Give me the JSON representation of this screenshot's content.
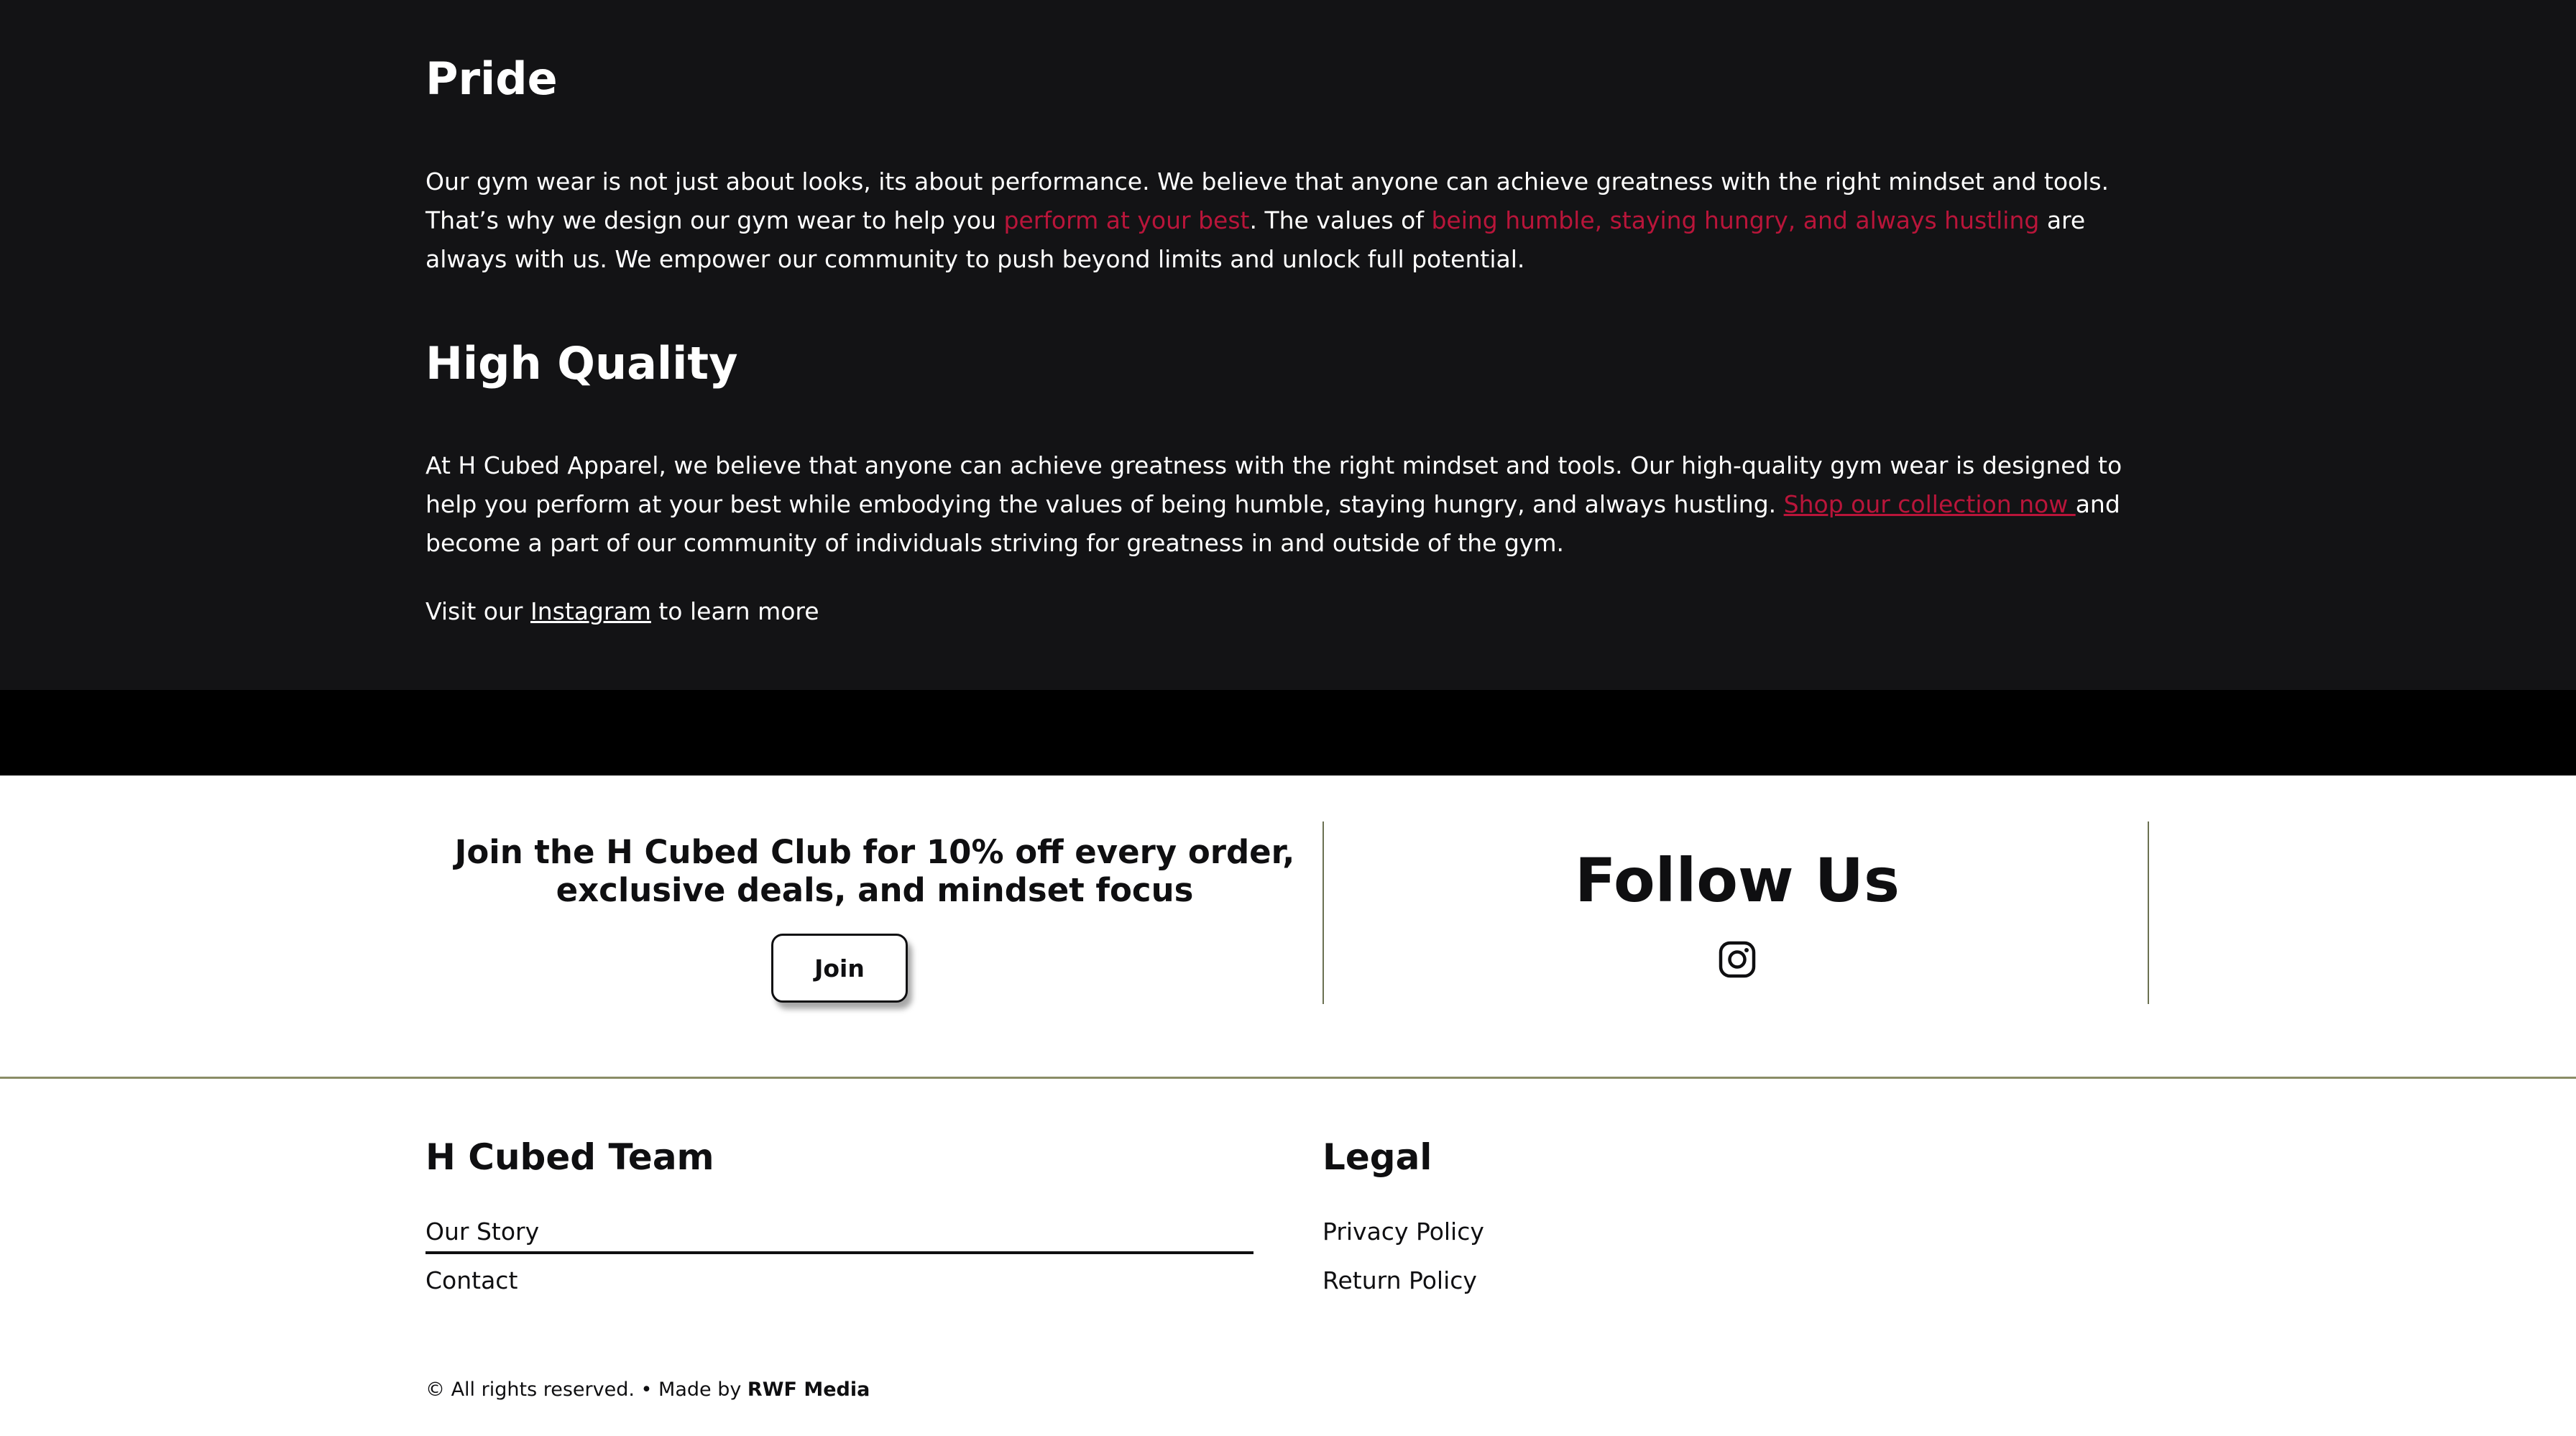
{
  "pride": {
    "heading": "Pride",
    "p1_a": "Our gym wear is not just about looks, its about performance. We believe that anyone can achieve greatness with the right mindset and tools. That’s why we design our gym wear to help you ",
    "p1_hl1": "perform at your best",
    "p1_b": ". The values of ",
    "p1_hl2": "being humble, staying hungry, and always hustling",
    "p1_c": " are always with us. We empower our community to push beyond limits and unlock full potential."
  },
  "quality": {
    "heading": "High Quality",
    "p2_a": "At H Cubed Apparel, we believe that anyone can achieve greatness with the right mindset and tools. Our high-quality gym wear is designed to help you perform at your best while embodying the values of being humble, staying hungry, and always hustling. ",
    "p2_link": "Shop our collection now ",
    "p2_b": "and become a part of our community of individuals striving for greatness in and outside of the gym.",
    "visit_a": "Visit our ",
    "visit_link": "Instagram",
    "visit_b": " to learn more"
  },
  "promo": {
    "join_line1": "Join the H Cubed Club for 10% off every order,",
    "join_line2": "exclusive deals, and mindset focus",
    "join_button": "Join",
    "follow_title": "Follow Us",
    "follow_icon": "instagram-icon"
  },
  "footer": {
    "team_heading": "H Cubed Team",
    "team_links": [
      "Our Story",
      "Contact"
    ],
    "legal_heading": "Legal",
    "legal_links": [
      "Privacy Policy",
      "Return Policy"
    ],
    "copyright_prefix": "© All rights reserved. • Made by ",
    "copyright_brand": "RWF Media"
  },
  "colors": {
    "dark_bg": "#131315",
    "accent": "#b9153a",
    "divider": "#6b7152"
  }
}
